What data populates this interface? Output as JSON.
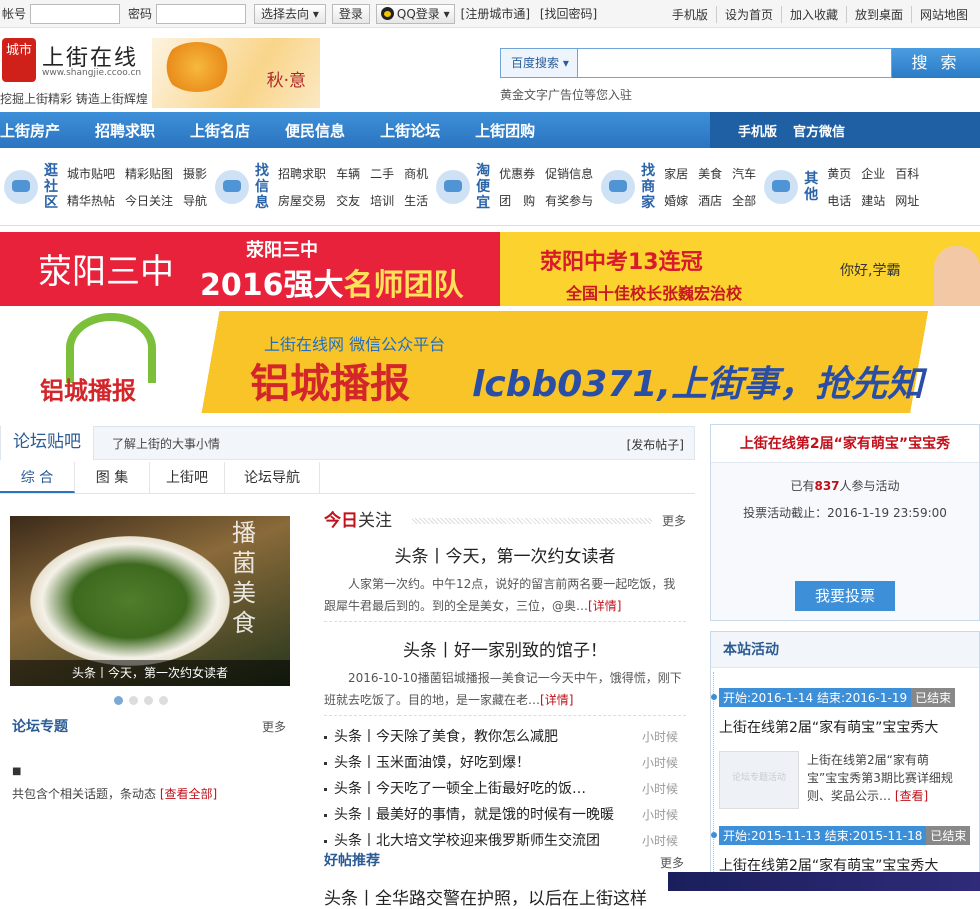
{
  "topbar": {
    "account_label": "帐号",
    "password_label": "密码",
    "select_label": "选择去向",
    "login_label": "登录",
    "qq_label": "QQ登录",
    "register_label": "[注册城市通]",
    "forgot_label": "[找回密码]",
    "right_links": [
      "手机版",
      "设为首页",
      "加入收藏",
      "放到桌面",
      "网站地图"
    ]
  },
  "header": {
    "logo_seal": "城市",
    "logo_name": "上街在线",
    "logo_url": "www.shangjie.ccoo.cn",
    "slogan": "挖掘上街精彩 铸造上街辉煌",
    "season_text": "秋·意",
    "search_select": "百度搜索",
    "search_button": "搜 索",
    "ad_text": "黄金文字广告位等您入驻"
  },
  "nav": {
    "items": [
      "上街房产",
      "招聘求职",
      "上街名店",
      "便民信息",
      "上街论坛",
      "上街团购"
    ],
    "right": [
      "手机版",
      "官方微信"
    ]
  },
  "quick": {
    "groups": [
      {
        "title": "逛社区",
        "links": [
          "城市贴吧",
          "精彩贴图",
          "摄影",
          "精华热帖",
          "今日关注",
          "导航"
        ]
      },
      {
        "title": "找信息",
        "links": [
          "招聘求职",
          "车辆",
          "二手",
          "商机",
          "房屋交易",
          "交友",
          "培训",
          "生活"
        ]
      },
      {
        "title": "淘便宜",
        "links": [
          "优惠券",
          "促销信息",
          "团　购",
          "有奖参与"
        ]
      },
      {
        "title": "找商家",
        "links": [
          "家居",
          "美食",
          "汽车",
          "婚嫁",
          "酒店",
          "全部"
        ]
      },
      {
        "title": "其他",
        "links": [
          "黄页",
          "企业",
          "百科",
          "电话",
          "建站",
          "网址"
        ]
      }
    ]
  },
  "banner1": {
    "school": "荥阳三中",
    "sub": "荥阳三中",
    "line_a": "2016强大",
    "line_b": "名师团队",
    "right_a": "荥阳中考13连冠",
    "right_b": "全国十佳校长张巍宏治校",
    "right_c": "你好,学霸"
  },
  "banner2": {
    "logo_text": "铝城播报",
    "line1": "上街在线网  微信公众平台",
    "line2": "铝城播报",
    "line3": "lcbb0371,上街事，抢先知"
  },
  "forum": {
    "title": "论坛贴吧",
    "subtitle": "了解上街的大事小情",
    "post_link": "[发布帖子]",
    "tabs": [
      "综 合",
      "图 集",
      "上街吧",
      "论坛导航"
    ],
    "photo_vertical": "播菌美食",
    "photo_caption": "头条丨今天，第一次约女读者",
    "topic_title": "论坛专题",
    "topic_more": "更多",
    "topic_small": "■",
    "topic_info": "共包含个相关话题，条动态",
    "topic_view_all": "[查看全部]"
  },
  "today": {
    "title_red": "今日",
    "title_rest": "关注",
    "more": "更多",
    "articles": [
      {
        "headline": "头条丨今天，第一次约女读者",
        "summary": "人家第一次约。中午12点，说好的留言前两名要一起吃饭，我跟犀牛君最后到的。到的全是美女，三位，@奥…",
        "detail": "[详情]"
      },
      {
        "headline": "头条丨好一家别致的馆子！",
        "summary": "2016-10-10播菌铝城播报—美食记一今天中午，饿得慌，刚下班就去吃饭了。目的地，是一家藏在老…",
        "detail": "[详情]"
      }
    ],
    "list": [
      {
        "text": "头条丨今天除了美食，教你怎么减肥",
        "time": "小时候"
      },
      {
        "text": "头条丨玉米面油馍，好吃到爆！",
        "time": "小时候"
      },
      {
        "text": "头条丨今天吃了一顿全上街最好吃的饭…",
        "time": "小时候"
      },
      {
        "text": "头条丨最美好的事情，就是饿的时候有一晚暖",
        "time": "小时候"
      },
      {
        "text": "头条丨北大培文学校迎来俄罗斯师生交流团",
        "time": "小时候"
      }
    ],
    "good_title": "好帖推荐",
    "good_more": "更多",
    "good_next": "头条丨全华路交警在护照，以后在上街这样"
  },
  "vote": {
    "title": "上街在线第2届“家有萌宝”宝宝秀",
    "participants_prefix": "已有",
    "participants": "837",
    "participants_suffix": "人参与活动",
    "deadline": "投票活动截止：2016-1-19 23:59:00",
    "button": "我要投票"
  },
  "activities": {
    "title": "本站活动",
    "items": [
      {
        "date": "开始:2016-1-14 结束:2016-1-19",
        "status": "已结束",
        "title": "上街在线第2届“家有萌宝”宝宝秀大",
        "desc": "上街在线第2届“家有萌宝”宝宝秀第3期比赛详细规则、奖品公示…",
        "view": "[查看]",
        "thumb": "论坛专题活动"
      },
      {
        "date": "开始:2015-11-13 结束:2015-11-18",
        "status": "已结束",
        "title": "上街在线第2届“家有萌宝”宝宝秀大"
      }
    ]
  }
}
